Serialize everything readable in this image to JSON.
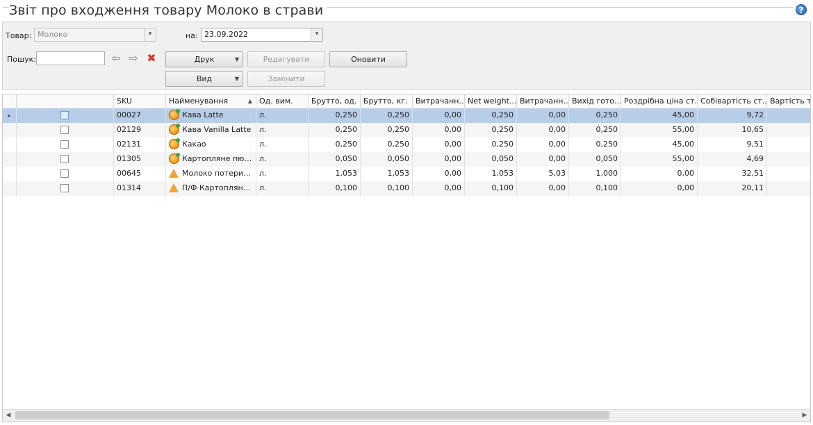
{
  "window": {
    "title": "Звіт про входження товару Молоко в страви"
  },
  "filters": {
    "product_label": "Товар:",
    "product_value": "Молоко",
    "date_label": "на:",
    "date_value": "23.09.2022",
    "search_label": "Пошук:",
    "search_value": ""
  },
  "toolbar": {
    "print_label": "Друк",
    "view_label": "Вид",
    "edit_label": "Редагувати",
    "replace_label": "Замінити",
    "refresh_label": "Оновити"
  },
  "table": {
    "columns": [
      "",
      "SKU",
      "Найменування",
      "Од. вим.",
      "Брутто, од.",
      "Брутто, кг.",
      "Витрачанн...",
      "Net weight...",
      "Витрачанн...",
      "Вихід гото...",
      "Роздрібна ціна ст...",
      "Собівартість ст...",
      "Вартість то"
    ],
    "rows": [
      {
        "sku": "00027",
        "name": "Кава Latte",
        "icon": "dish-icon",
        "unit": "л.",
        "gross_unit": "0,250",
        "gross_kg": "0,250",
        "spend1": "0,00",
        "net": "0,250",
        "spend2": "0,00",
        "yield": "0,250",
        "price": "45,00",
        "cost": "9,72",
        "selected": true
      },
      {
        "sku": "02129",
        "name": "Кава Vanilla Latte",
        "icon": "dish-icon",
        "unit": "л.",
        "gross_unit": "0,250",
        "gross_kg": "0,250",
        "spend1": "0,00",
        "net": "0,250",
        "spend2": "0,00",
        "yield": "0,250",
        "price": "55,00",
        "cost": "10,65",
        "selected": false
      },
      {
        "sku": "02131",
        "name": "Какао",
        "icon": "dish-icon",
        "unit": "л.",
        "gross_unit": "0,250",
        "gross_kg": "0,250",
        "spend1": "0,00",
        "net": "0,250",
        "spend2": "0,00",
        "yield": "0,250",
        "price": "45,00",
        "cost": "9,51",
        "selected": false
      },
      {
        "sku": "01305",
        "name": "Картопляне пюре",
        "icon": "dish-icon",
        "unit": "л.",
        "gross_unit": "0,050",
        "gross_kg": "0,050",
        "spend1": "0,00",
        "net": "0,050",
        "spend2": "0,00",
        "yield": "0,050",
        "price": "55,00",
        "cost": "4,69",
        "selected": false
      },
      {
        "sku": "00645",
        "name": "Молоко потери н...",
        "icon": "semi-product-icon",
        "unit": "л.",
        "gross_unit": "1,053",
        "gross_kg": "1,053",
        "spend1": "0,00",
        "net": "1,053",
        "spend2": "5,03",
        "yield": "1,000",
        "price": "0,00",
        "cost": "32,51",
        "selected": false
      },
      {
        "sku": "01314",
        "name": "П/Ф Картопляне ...",
        "icon": "semi-product-icon",
        "unit": "л.",
        "gross_unit": "0,100",
        "gross_kg": "0,100",
        "spend1": "0,00",
        "net": "0,100",
        "spend2": "0,00",
        "yield": "0,100",
        "price": "0,00",
        "cost": "20,11",
        "selected": false
      }
    ]
  }
}
